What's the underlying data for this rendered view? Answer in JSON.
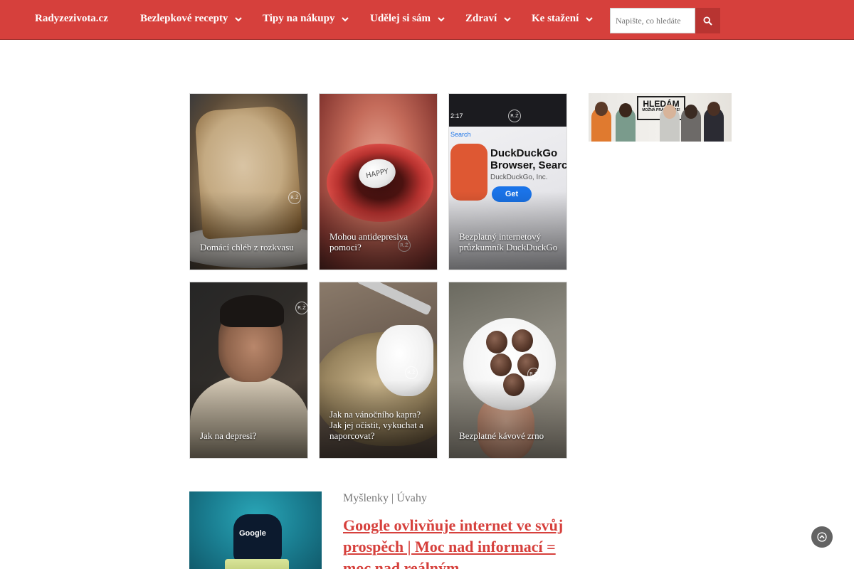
{
  "navbar": {
    "brand": "Radyzezivota.cz",
    "items": [
      {
        "label": "Bezlepkové recepty"
      },
      {
        "label": "Tipy na nákupy"
      },
      {
        "label": "Udělej si sám"
      },
      {
        "label": "Zdraví"
      },
      {
        "label": "Ke stažení"
      }
    ],
    "search_placeholder": "Napište, co hledáte",
    "colors": {
      "accent": "#d6403c",
      "search_button": "#b83431"
    }
  },
  "cards": [
    {
      "caption": "Domácí chléb z rozkvasu"
    },
    {
      "caption": "Mohou antidepresiva pomoci?",
      "pill_text": "HAPPY"
    },
    {
      "caption": "Bezplatný internetový průzkumník DuckDuckGo",
      "phone": {
        "time": "2:17",
        "search_label": "Search",
        "app_name": "DuckDuckGo Browser, Search",
        "publisher": "DuckDuckGo, Inc.",
        "get_button": "Get"
      }
    },
    {
      "caption": "Jak na depresi?"
    },
    {
      "caption": "Jak na vánočního kapra? Jak jej očistit, vykuchat a naporcovat?"
    },
    {
      "caption": "Bezplatné kávové zrno"
    }
  ],
  "sidebar_ad": {
    "headline": "HLEDÁM",
    "subline": "MOŽNÁ PRÁVĚ TEBE!"
  },
  "article": {
    "category_1": "Myšlenky",
    "separator": " | ",
    "category_2": "Úvahy",
    "title": "Google ovlivňuje internet ve svůj prospěch | Moc nad informací = moc nad reálným",
    "thumb_label": "Google"
  },
  "icons": {
    "search": "search-icon",
    "chevron": "chevron-down-icon",
    "back_to_top": "chevron-up-icon",
    "watermark": "watermark-icon"
  }
}
